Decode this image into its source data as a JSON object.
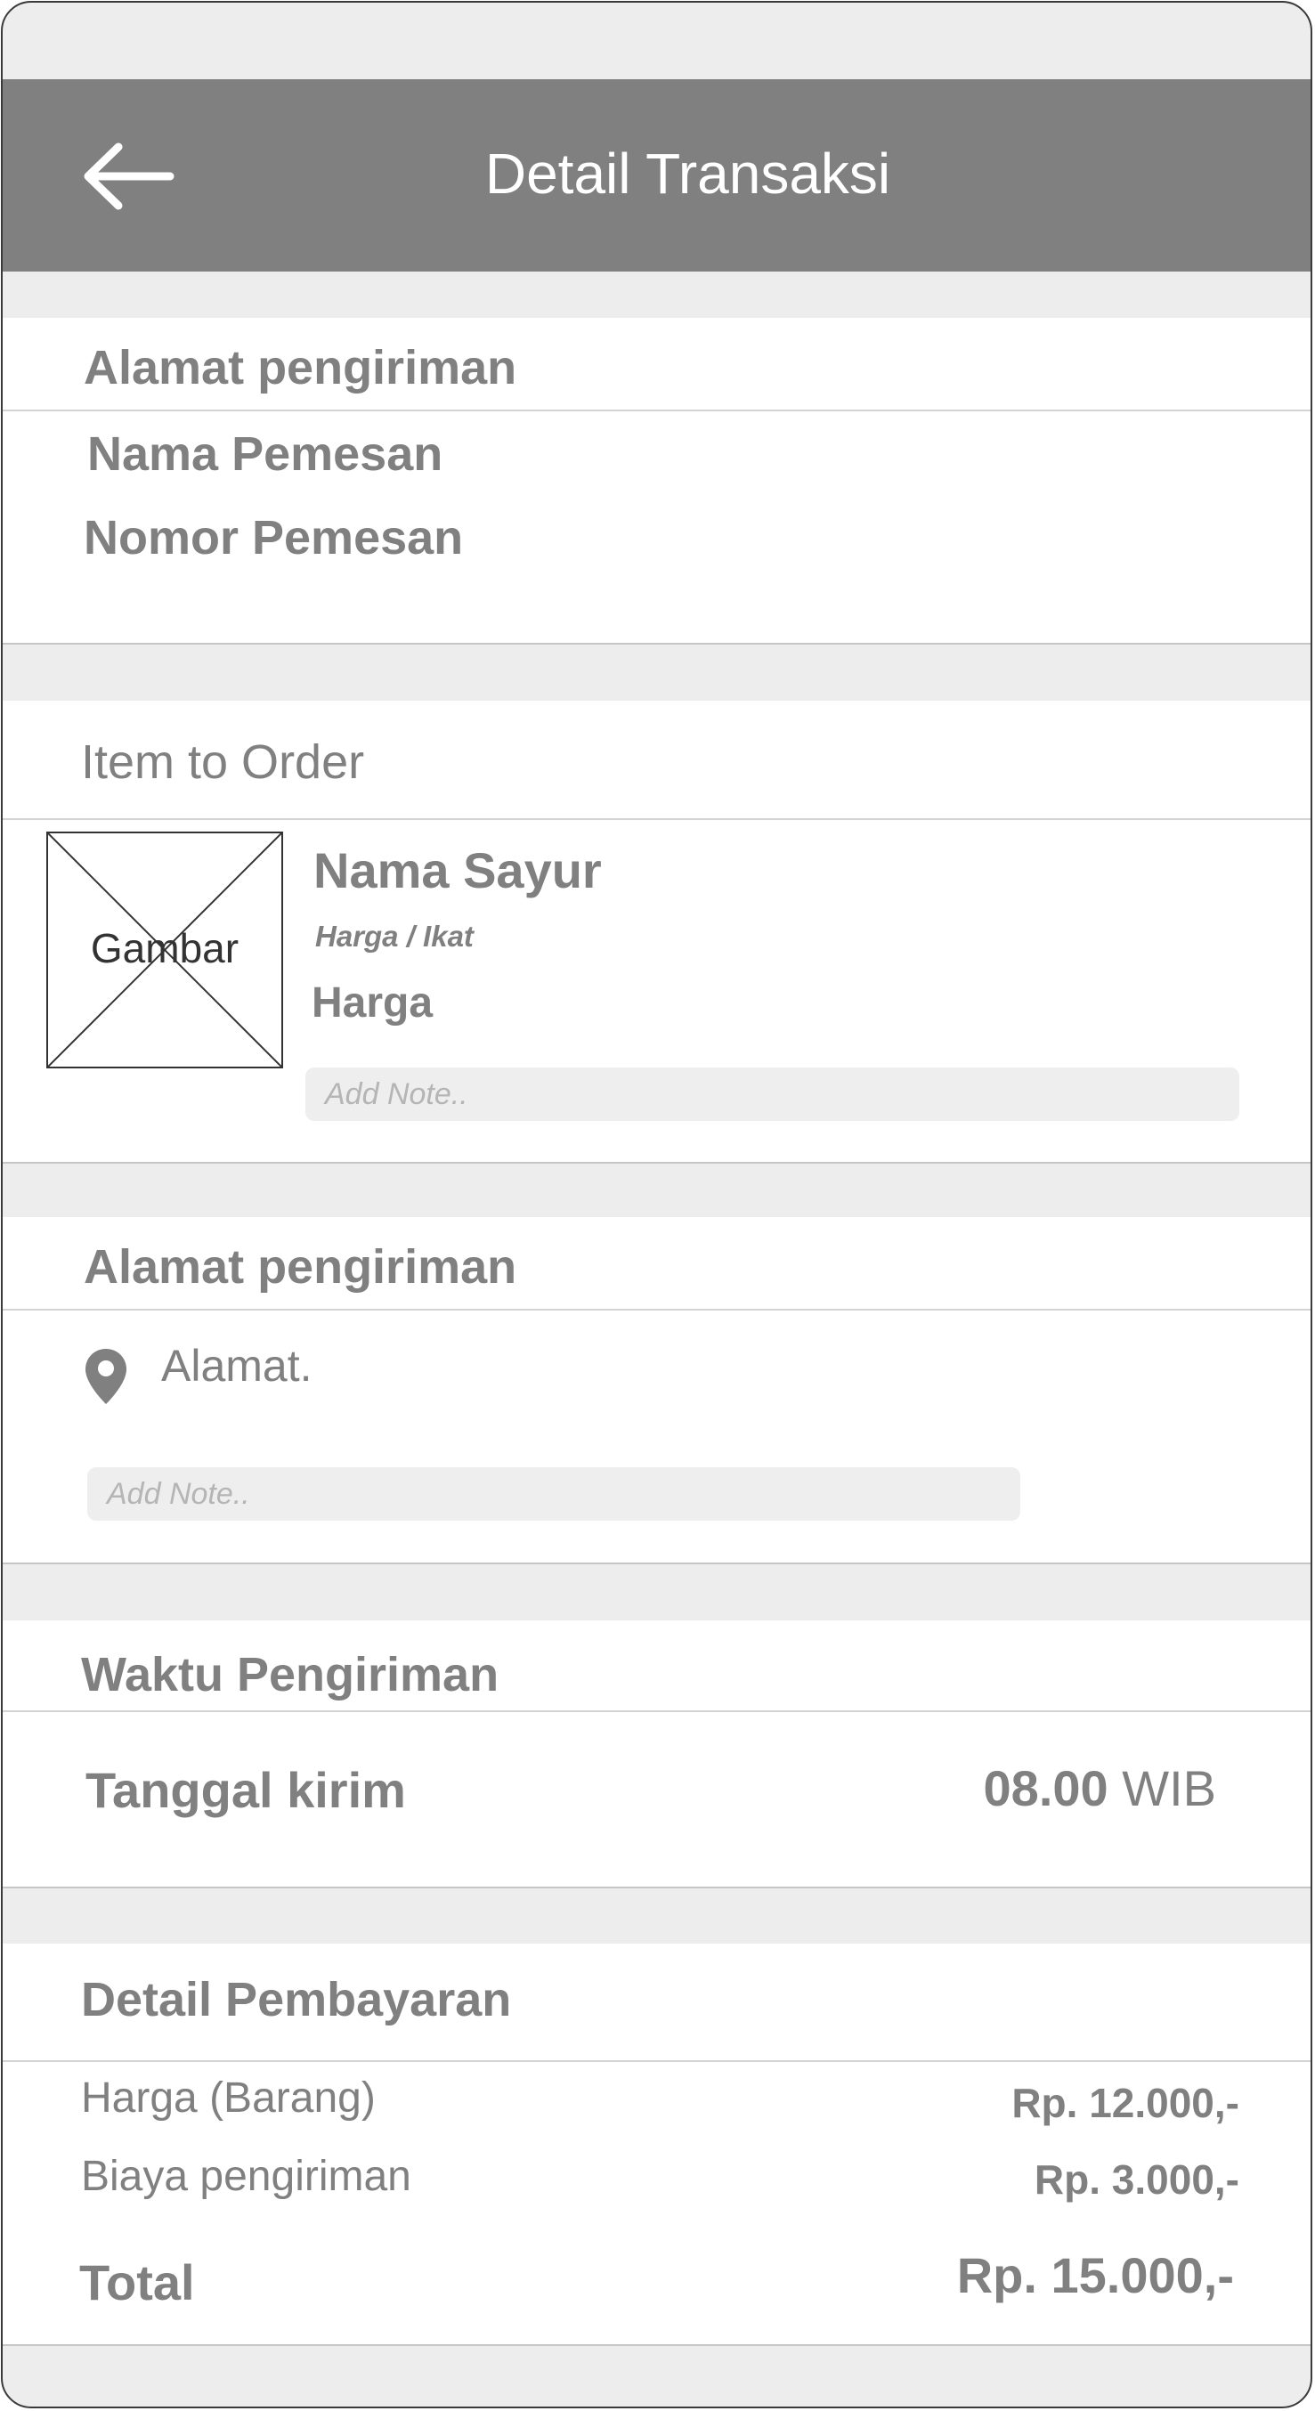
{
  "header": {
    "title": "Detail Transaksi",
    "back_icon": "arrow-left-icon"
  },
  "customer": {
    "section_title": "Alamat pengiriman",
    "name_label": "Nama Pemesan",
    "phone_label": "Nomor Pemesan"
  },
  "order": {
    "section_title": "Item to Order",
    "item": {
      "image_label": "Gambar",
      "name": "Nama Sayur",
      "unit_price_label": "Harga / Ikat",
      "price_label": "Harga",
      "note_placeholder": "Add Note.."
    }
  },
  "shipping": {
    "section_title": "Alamat pengiriman",
    "location_icon": "map-pin-icon",
    "address": "Alamat.",
    "note_placeholder": "Add Note.."
  },
  "delivery_time": {
    "section_title": "Waktu Pengiriman",
    "date_label": "Tanggal kirim",
    "time_value": "08.00",
    "time_zone": "WIB"
  },
  "payment": {
    "section_title": "Detail Pembayaran",
    "rows": [
      {
        "label": "Harga (Barang)",
        "value": "Rp. 12.000,-"
      },
      {
        "label": "Biaya pengiriman",
        "value": "Rp. 3.000,-"
      }
    ],
    "total_label": "Total",
    "total_value": "Rp. 15.000,-"
  },
  "colors": {
    "appbar": "#808080",
    "background": "#ededed",
    "text": "#808080",
    "note_field": "#eeeeee"
  }
}
